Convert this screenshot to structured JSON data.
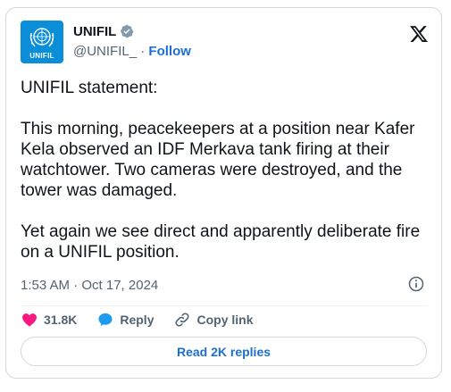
{
  "account": {
    "display_name": "UNIFIL",
    "handle": "@UNIFIL_",
    "separator": "·",
    "follow_label": "Follow",
    "avatar_text": "UNIFIL"
  },
  "tweet": {
    "paragraphs": [
      "UNIFIL statement:",
      "This morning, peacekeepers at a position near Kafer Kela observed an IDF Merkava tank firing at their watchtower. Two cameras were destroyed, and the tower was damaged.",
      "Yet again we see direct and apparently deliberate fire on a UNIFIL position."
    ],
    "timestamp": "1:53 AM · Oct 17, 2024"
  },
  "actions": {
    "likes": "31.8K",
    "reply_label": "Reply",
    "copy_link_label": "Copy link"
  },
  "replies_button": "Read 2K replies",
  "colors": {
    "accent": "#1d6fd1",
    "like": "#f91880",
    "avatar_bg": "#0b8ed8",
    "muted": "#536471"
  }
}
